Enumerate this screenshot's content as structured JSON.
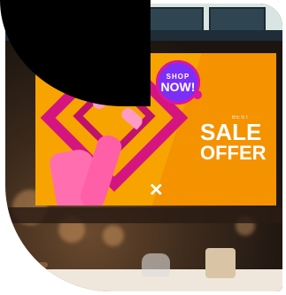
{
  "poster": {
    "badge_top": "SHOP",
    "badge_main": "NOW!",
    "kicker": "BEST",
    "headline_1": "SALE",
    "headline_2": "OFFER"
  },
  "colors": {
    "poster_bg": "#f7a400",
    "magenta": "#d4157f",
    "purple": "#7b2ff7",
    "pink": "#ff6fb0"
  }
}
